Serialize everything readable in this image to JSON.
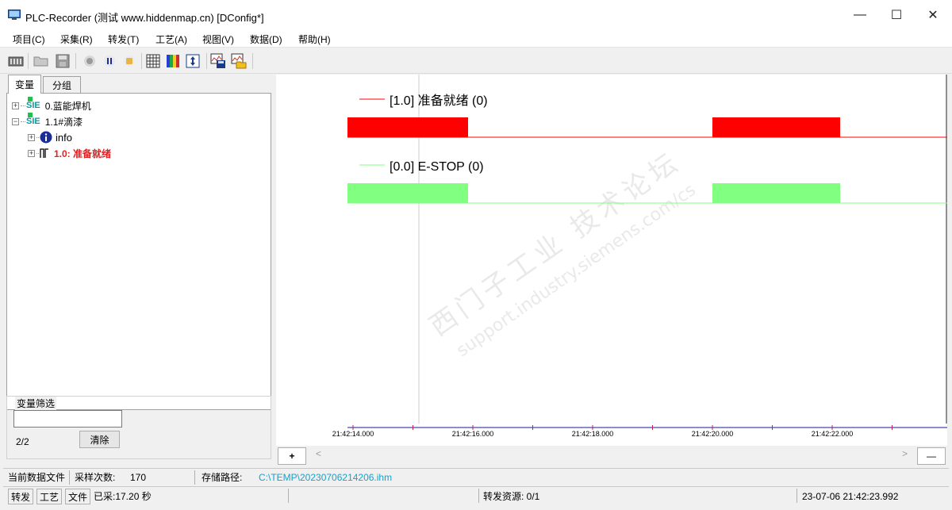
{
  "window": {
    "title": "PLC-Recorder (测试 www.hiddenmap.cn) [DConfig*]",
    "minimize_glyph": "—",
    "maximize_glyph": "☐",
    "close_glyph": "✕"
  },
  "menu": [
    "项目(C)",
    "采集(R)",
    "转发(T)",
    "工艺(A)",
    "视图(V)",
    "数据(D)",
    "帮助(H)"
  ],
  "toolbar_icons": [
    "plc-rack-icon",
    "open-folder-icon",
    "save-icon",
    "record-icon",
    "pause-icon",
    "stop-icon",
    "grid-icon",
    "color-palette-icon",
    "vertical-resize-icon",
    "save-config-icon",
    "open-config-icon"
  ],
  "left_tabs": [
    "变量",
    "分组"
  ],
  "tree": {
    "node0_label": "0.蓝能焊机",
    "node1_label": "1.1#滴漆",
    "info_label": "info",
    "signal_label": "1.0: 准备就绪",
    "sie_text": "SIE",
    "expand_plus": "+",
    "expand_minus": "−"
  },
  "filter": {
    "group_label": "变量筛选",
    "input_value": "",
    "count": "2/2",
    "clear_label": "清除"
  },
  "chart": {
    "signals": [
      {
        "legend": "[1.0] 准备就绪 (0)",
        "color": "#ff0000"
      },
      {
        "legend": "[0.0] E-STOP (0)",
        "color": "#80ff80"
      }
    ],
    "time_labels": [
      "21:42:14.000",
      "21:42:16.000",
      "21:42:18.000",
      "21:42:20.000",
      "21:42:22.000"
    ],
    "watermark_cn": "西门子工业 技术论坛",
    "watermark_url": "support.industry.siemens.com/cs"
  },
  "chart_controls": {
    "add_label": "+",
    "remove_label": "—",
    "scroll_left": "<",
    "scroll_right": ">"
  },
  "status1": {
    "current_file_label": "当前数据文件",
    "sample_count_label": "采样次数:",
    "sample_count": "170",
    "path_label": "存储路径:",
    "path_value": "C:\\TEMP\\20230706214206.ihm"
  },
  "status2": {
    "forward_label": "转发",
    "process_label": "工艺",
    "file_label": "文件",
    "elapsed": "已采:17.20 秒",
    "forward_resource": "转发资源:  0/1",
    "timestamp": "23-07-06 21:42:23.992"
  }
}
